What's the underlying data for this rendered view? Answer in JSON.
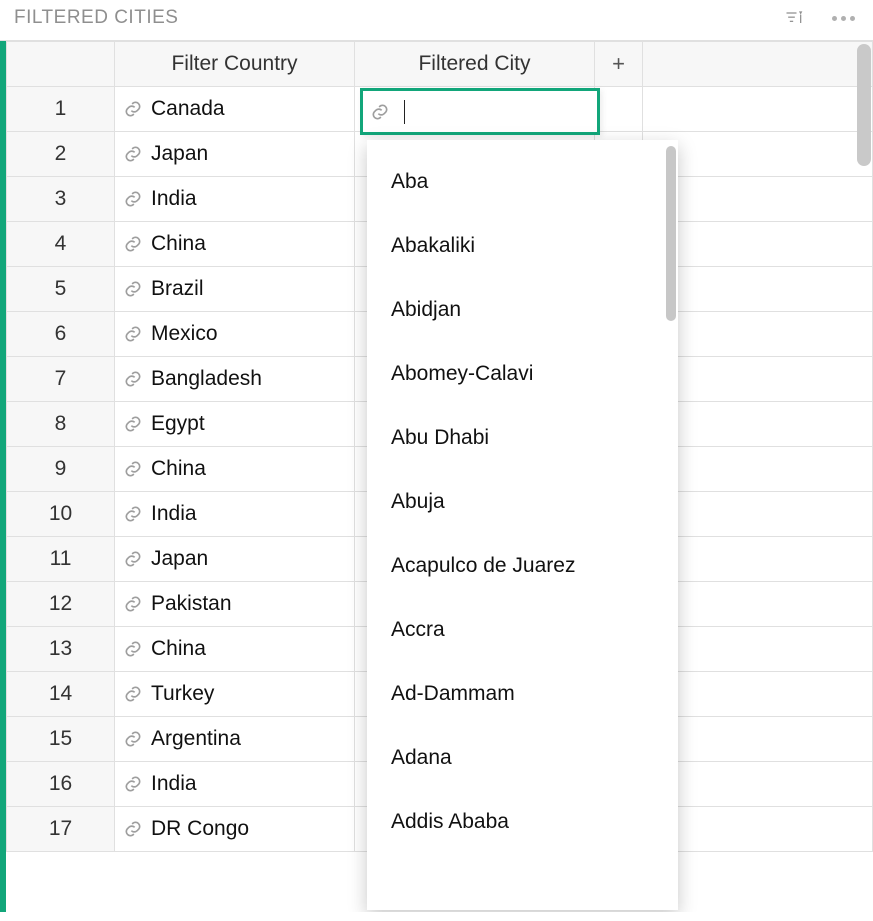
{
  "header": {
    "title": "FILTERED CITIES"
  },
  "columns": {
    "country": "Filter Country",
    "city": "Filtered City",
    "add": "+"
  },
  "rows": [
    {
      "n": "1",
      "country": "Canada"
    },
    {
      "n": "2",
      "country": "Japan"
    },
    {
      "n": "3",
      "country": "India"
    },
    {
      "n": "4",
      "country": "China"
    },
    {
      "n": "5",
      "country": "Brazil"
    },
    {
      "n": "6",
      "country": "Mexico"
    },
    {
      "n": "7",
      "country": "Bangladesh"
    },
    {
      "n": "8",
      "country": "Egypt"
    },
    {
      "n": "9",
      "country": "China"
    },
    {
      "n": "10",
      "country": "India"
    },
    {
      "n": "11",
      "country": "Japan"
    },
    {
      "n": "12",
      "country": "Pakistan"
    },
    {
      "n": "13",
      "country": "China"
    },
    {
      "n": "14",
      "country": "Turkey"
    },
    {
      "n": "15",
      "country": "Argentina"
    },
    {
      "n": "16",
      "country": "India"
    },
    {
      "n": "17",
      "country": "DR Congo"
    }
  ],
  "editingCell": {
    "value": ""
  },
  "dropdown": {
    "items": [
      "Aba",
      "Abakaliki",
      "Abidjan",
      "Abomey-Calavi",
      "Abu Dhabi",
      "Abuja",
      "Acapulco de Juarez",
      "Accra",
      "Ad-Dammam",
      "Adana",
      "Addis Ababa"
    ]
  }
}
